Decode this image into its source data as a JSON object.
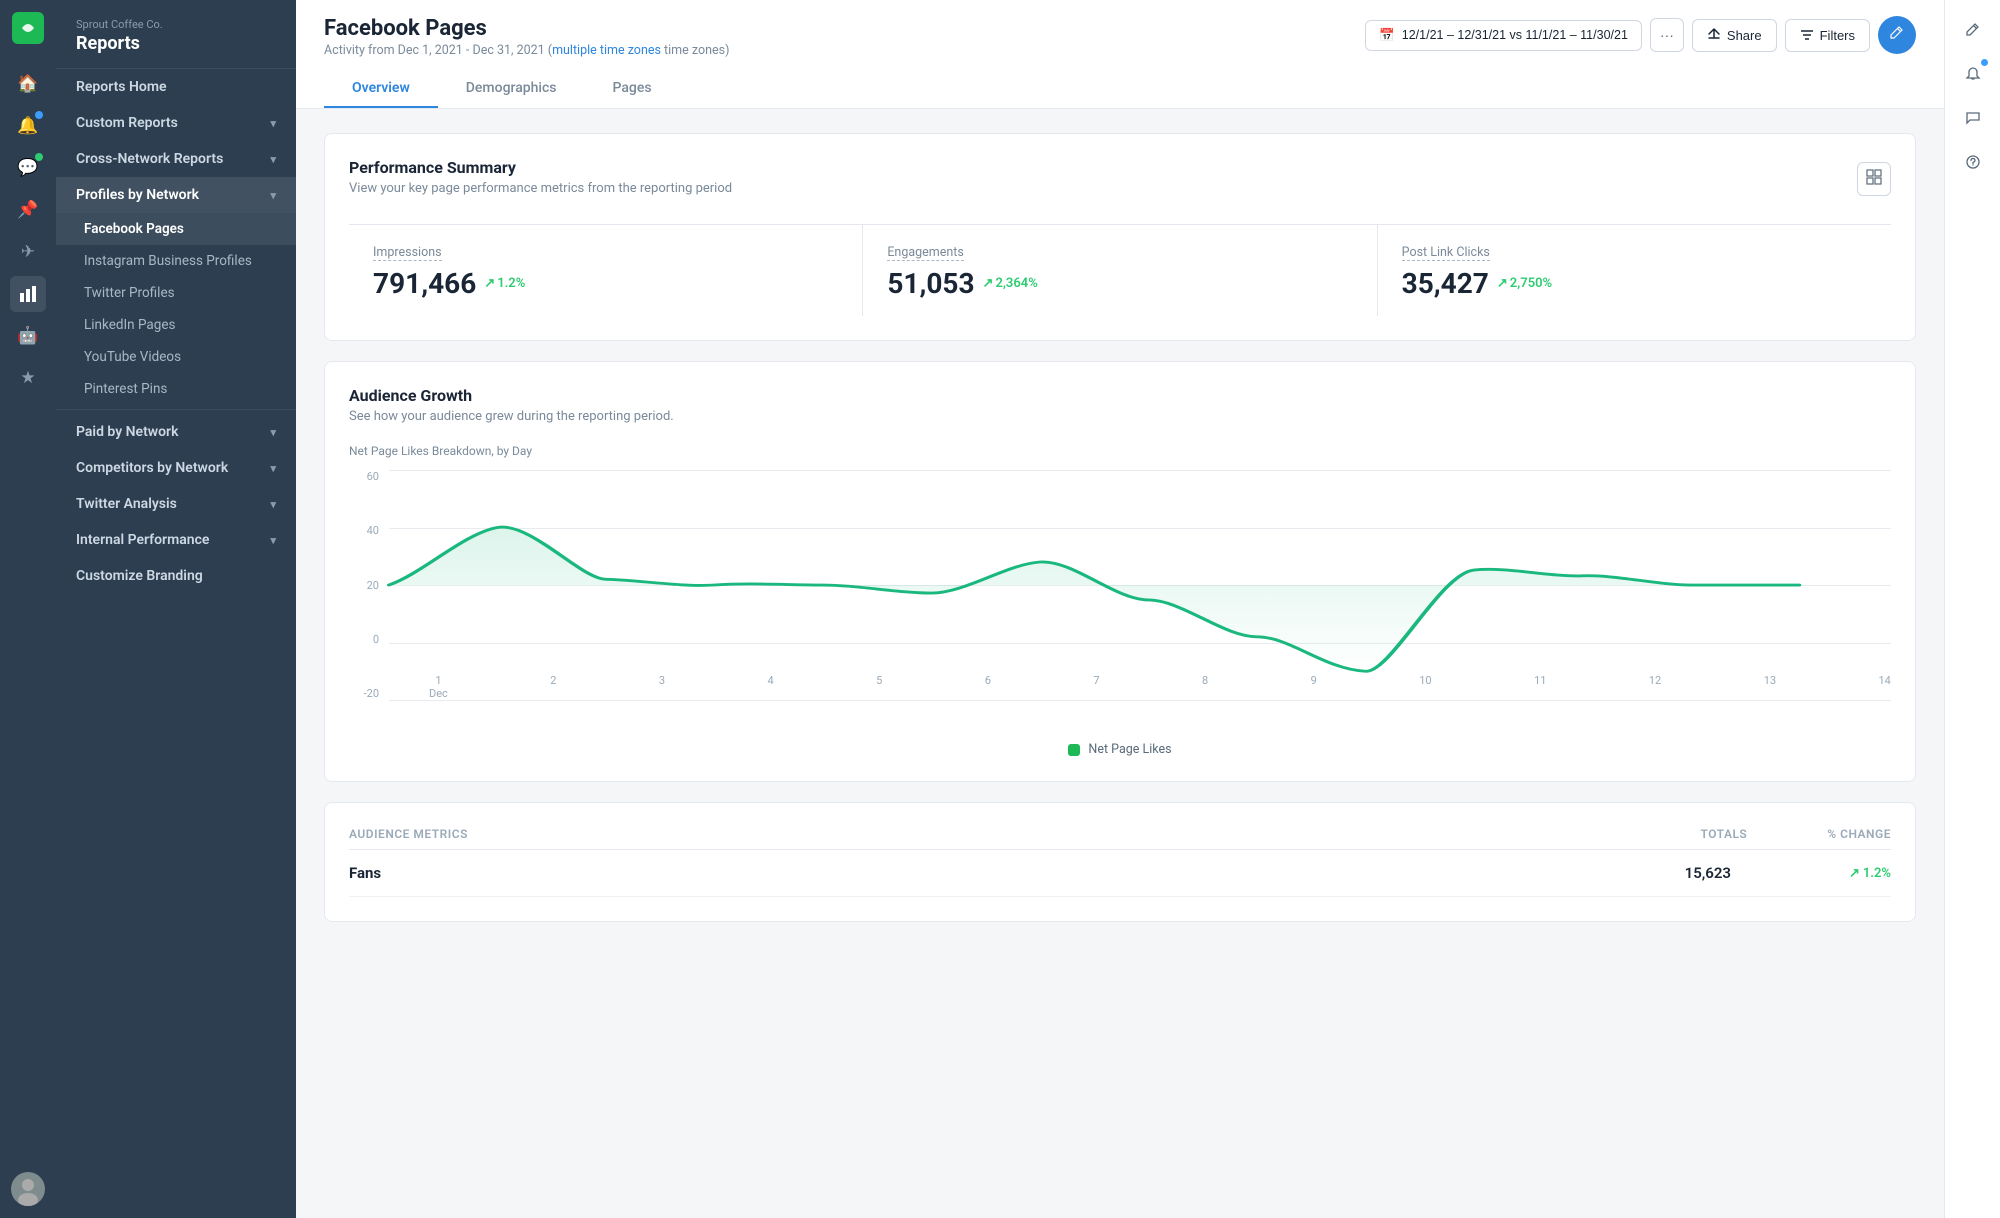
{
  "app": {
    "brand": "Sprout Coffee Co.",
    "section": "Reports"
  },
  "rail": {
    "icons": [
      {
        "name": "home-icon",
        "glyph": "⌂",
        "active": false
      },
      {
        "name": "bell-icon",
        "glyph": "🔔",
        "badge": "blue",
        "active": false
      },
      {
        "name": "chat-icon",
        "glyph": "💬",
        "badge": "green",
        "active": false
      },
      {
        "name": "pin-icon",
        "glyph": "📌",
        "active": false
      },
      {
        "name": "message-icon",
        "glyph": "✉",
        "active": false
      },
      {
        "name": "reports-icon",
        "glyph": "📊",
        "active": true
      },
      {
        "name": "bot-icon",
        "glyph": "🤖",
        "active": false
      },
      {
        "name": "star-icon",
        "glyph": "★",
        "active": false
      }
    ]
  },
  "sidebar": {
    "items": [
      {
        "label": "Reports Home",
        "expandable": false,
        "active": false
      },
      {
        "label": "Custom Reports",
        "expandable": true,
        "active": false
      },
      {
        "label": "Cross-Network Reports",
        "expandable": true,
        "active": false
      },
      {
        "label": "Profiles by Network",
        "expandable": true,
        "active": true
      }
    ],
    "sub_items": [
      {
        "label": "Facebook Pages",
        "active": true
      },
      {
        "label": "Instagram Business Profiles",
        "active": false
      },
      {
        "label": "Twitter Profiles",
        "active": false
      },
      {
        "label": "LinkedIn Pages",
        "active": false
      },
      {
        "label": "YouTube Videos",
        "active": false
      },
      {
        "label": "Pinterest Pins",
        "active": false
      }
    ],
    "bottom_items": [
      {
        "label": "Paid by Network",
        "expandable": true
      },
      {
        "label": "Competitors by Network",
        "expandable": true
      },
      {
        "label": "Twitter Analysis",
        "expandable": true
      },
      {
        "label": "Internal Performance",
        "expandable": true
      },
      {
        "label": "Customize Branding",
        "expandable": false
      }
    ]
  },
  "header": {
    "title": "Facebook Pages",
    "subtitle": "Activity from Dec 1, 2021 - Dec 31, 2021",
    "timezone_label": "multiple time zones",
    "date_range": "12/1/21 – 12/31/21 vs 11/1/21 – 11/30/21",
    "share_label": "Share",
    "filters_label": "Filters"
  },
  "tabs": [
    {
      "label": "Overview",
      "active": true
    },
    {
      "label": "Demographics",
      "active": false
    },
    {
      "label": "Pages",
      "active": false
    }
  ],
  "performance_summary": {
    "title": "Performance Summary",
    "subtitle": "View your key page performance metrics from the reporting period",
    "metrics": [
      {
        "label": "Impressions",
        "value": "791,466",
        "change": "1.2%"
      },
      {
        "label": "Engagements",
        "value": "51,053",
        "change": "2,364%"
      },
      {
        "label": "Post Link Clicks",
        "value": "35,427",
        "change": "2,750%"
      }
    ]
  },
  "audience_growth": {
    "title": "Audience Growth",
    "subtitle": "See how your audience grew during the reporting period.",
    "chart_label": "Net Page Likes Breakdown, by Day",
    "y_labels": [
      "60",
      "40",
      "20",
      "0",
      "-20"
    ],
    "x_labels": [
      "1\nDec",
      "2",
      "3",
      "4",
      "5",
      "6",
      "7",
      "8",
      "9",
      "10",
      "11",
      "12",
      "13",
      "14"
    ],
    "legend": "Net Page Likes"
  },
  "audience_table": {
    "title": "Audience Metrics",
    "col_totals": "Totals",
    "col_change": "% Change",
    "rows": [
      {
        "label": "Fans",
        "total": "15,623",
        "change": "1.2%"
      }
    ]
  }
}
